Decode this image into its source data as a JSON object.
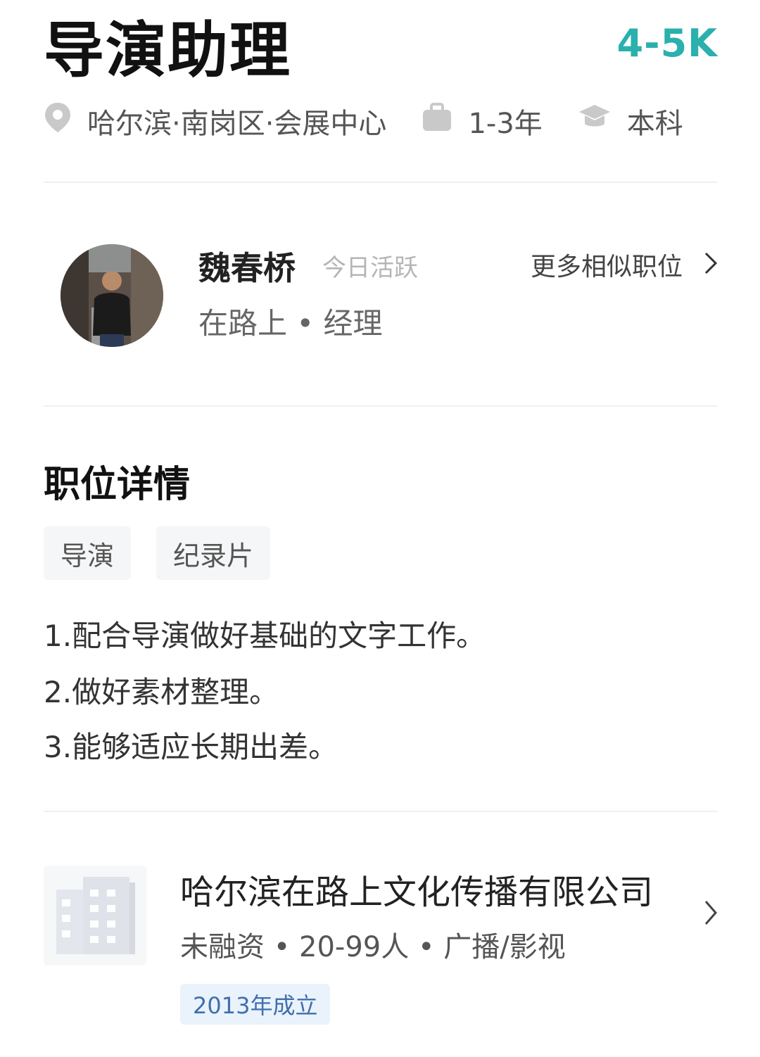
{
  "job": {
    "title": "导演助理",
    "salary": "4-5K",
    "location": "哈尔滨·南岗区·会展中心",
    "experience": "1-3年",
    "education": "本科"
  },
  "recruiter": {
    "name": "魏春桥",
    "status": "今日活跃",
    "company_and_role": "在路上 • 经理",
    "more_link": "更多相似职位"
  },
  "details": {
    "section_title": "职位详情",
    "tags": [
      "导演",
      "纪录片"
    ],
    "lines": [
      "1.配合导演做好基础的文字工作。",
      "2.做好素材整理。",
      "3.能够适应长期出差。"
    ]
  },
  "company": {
    "name": "哈尔滨在路上文化传播有限公司",
    "info": "未融资 • 20-99人 • 广播/影视",
    "founded": "2013年成立"
  },
  "colors": {
    "salary": "#2ab0ad",
    "badge_bg": "#eaf2fb",
    "badge_text": "#3f6fae"
  },
  "icons": [
    "location-pin-icon",
    "briefcase-icon",
    "graduation-cap-icon",
    "chevron-right-icon",
    "building-icon"
  ]
}
